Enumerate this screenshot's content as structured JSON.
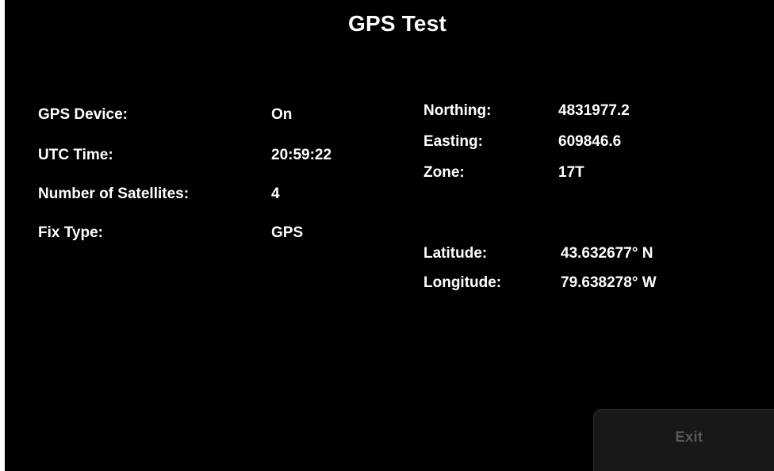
{
  "title": "GPS Test",
  "status": {
    "device_label": "GPS Device:",
    "device_value": "On",
    "utc_label": "UTC Time:",
    "utc_value": "20:59:22",
    "satellites_label": "Number of Satellites:",
    "satellites_value": "4",
    "fix_label": "Fix Type:",
    "fix_value": "GPS"
  },
  "utm": {
    "northing_label": "Northing:",
    "northing_value": "4831977.2",
    "easting_label": "Easting:",
    "easting_value": "609846.6",
    "zone_label": "Zone:",
    "zone_value": "17T"
  },
  "geo": {
    "latitude_label": "Latitude:",
    "latitude_value": "43.632677° N",
    "longitude_label": "Longitude:",
    "longitude_value": "79.638278° W"
  },
  "exit_label": "Exit",
  "colors": {
    "background": "#000000",
    "text": "#ffffff",
    "exit_button_bg": "#181818",
    "exit_text": "#5a5a5a"
  }
}
